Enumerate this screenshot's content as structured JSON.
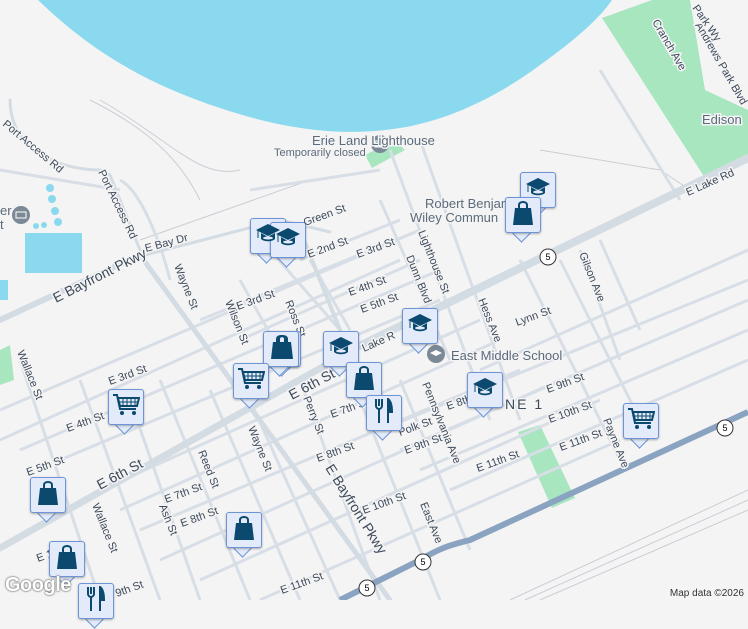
{
  "map": {
    "places": {
      "lighthouse": "Erie Land Lighthouse",
      "lighthouse_status": "Temporarily closed",
      "wiley_1": "Robert Benjamin",
      "wiley_2": "Wiley Commun",
      "east_middle": "East Middle School",
      "edison": "Edison",
      "zone": "NE 1",
      "left_poi_1": "er",
      "left_poi_2": "t"
    },
    "streets": {
      "e_lake_rd": "E Lake Rd",
      "lake_rd_partial": "Lake R",
      "e_6th_st": "E 6th St",
      "e_6th_st_2": "E 6th St",
      "e_bayfront_pkwy": "E Bayfront Pkwy",
      "e_bayfront_pkwy_2": "E Bayfront Pkwy",
      "port_access_rd": "Port Access Rd",
      "port_access_rd_2": "Port Access Rd",
      "e_bay_dr": "E Bay Dr",
      "wayne_st": "Wayne St",
      "wayne_st_2": "Wayne St",
      "wilson_st": "Wilson St",
      "ross_st": "Ross St",
      "green_st": "Green St",
      "e_2nd_st": "E 2nd St",
      "e_3rd_st": "E 3rd St",
      "e_3rd_st_2": "E 3rd St",
      "e_3rd_st_3": "E 3rd St",
      "e_4th_st": "E 4th St",
      "e_4th_st_2": "E 4th St",
      "e_5th_st": "E 5th St",
      "e_5th_st_2": "E 5th St",
      "e_7th_st": "E 7th St",
      "e_7th_st_2": "E 7th St",
      "e_8th_st": "E 8th St",
      "e_8th_st_2": "E 8th St",
      "e_8th_st_3": "E 8th",
      "e_9th_st": "E 9th St",
      "e_9th_st_2": "E 9th St",
      "e_9th_st_3": "9th St",
      "e_10th_st": "E 10th St",
      "e_10th_st_2": "E 10th St",
      "e_11th_st": "E 11th St",
      "e_11th_st_2": "E 11th St",
      "e_11th_st_3": "E 11th St",
      "dunn_blvd": "Dunn Blvd",
      "lighthouse_st": "Lighthouse St",
      "hess_ave": "Hess Ave",
      "lynn_st": "Lynn St",
      "gilson_ave": "Gilson Ave",
      "payne_ave": "Payne Ave",
      "pennsylvania_ave": "Pennsylvania Ave",
      "polk_st": "Polk St",
      "east_ave": "East Ave",
      "perry_st": "Perry St",
      "reed_st": "Reed St",
      "ash_st": "Ash St",
      "wallace_st": "Wallace St",
      "wallace_st_2": "Wallace St",
      "cranch_ave": "Cranch Ave",
      "andrews_park_blvd": "Andrews Park Blvd",
      "park_wy": "Park Wy",
      "e_1": "E 1"
    },
    "route_shield": "5",
    "markers": [
      {
        "type": "school-icon"
      },
      {
        "type": "school-icon"
      },
      {
        "type": "school-icon"
      },
      {
        "type": "school-icon"
      },
      {
        "type": "school-icon"
      },
      {
        "type": "school-icon"
      },
      {
        "type": "shopping-bag-icon"
      },
      {
        "type": "shopping-bag-icon"
      },
      {
        "type": "shopping-bag-icon"
      },
      {
        "type": "shopping-bag-icon"
      },
      {
        "type": "shopping-bag-icon"
      },
      {
        "type": "shopping-bag-icon"
      },
      {
        "type": "shopping-bag-icon"
      },
      {
        "type": "shopping-cart-icon"
      },
      {
        "type": "shopping-cart-icon"
      },
      {
        "type": "shopping-cart-icon"
      },
      {
        "type": "restaurant-icon"
      },
      {
        "type": "restaurant-icon"
      }
    ],
    "colors": {
      "water": "#8ad9ee",
      "park": "#a8e6c0",
      "road": "#d5dde5",
      "highway": "#8aa3c0",
      "marker_icon": "#0b4a6e"
    },
    "logo": "Google",
    "attribution": "Map data ©2026"
  }
}
